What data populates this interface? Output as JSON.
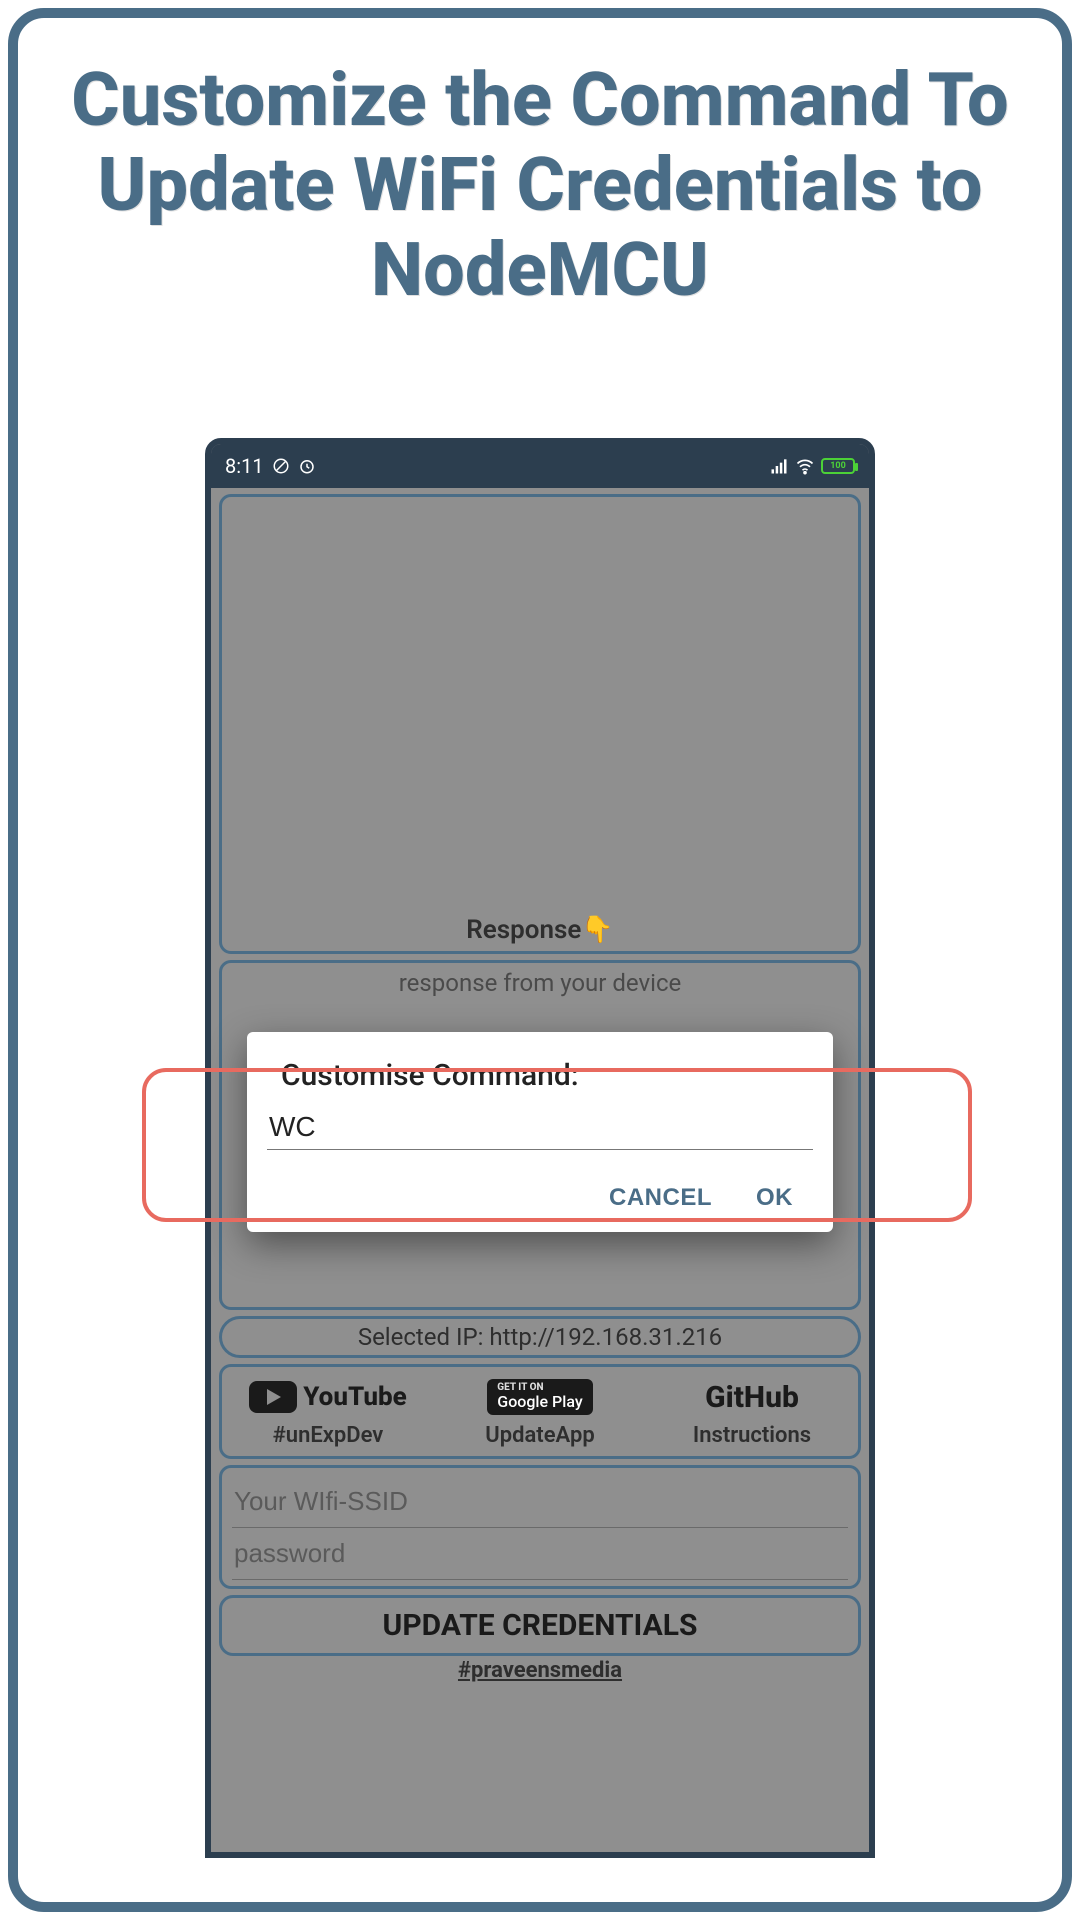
{
  "promo": {
    "title": "Customize the Command To Update WiFi Credentials to NodeMCU"
  },
  "statusbar": {
    "time": "8:11",
    "battery_text": "100"
  },
  "app": {
    "response_label": "Response",
    "response_emoji": "👇",
    "response_sub": "response from your device",
    "selected_ip": "Selected IP: http://192.168.31.216",
    "ssid_placeholder": "Your WIfi-SSID",
    "password_placeholder": "password",
    "update_button": "UPDATE CREDENTIALS",
    "footer": "#praveensmedia"
  },
  "links": {
    "youtube_label": "YouTube",
    "youtube_sub": "#unExpDev",
    "play_top": "GET IT ON",
    "play_label": "Google Play",
    "play_sub": "UpdateApp",
    "github_label": "GitHub",
    "github_sub": "Instructions"
  },
  "dialog": {
    "title": "Customise Command:",
    "value": "WC",
    "cancel": "CANCEL",
    "ok": "OK"
  }
}
